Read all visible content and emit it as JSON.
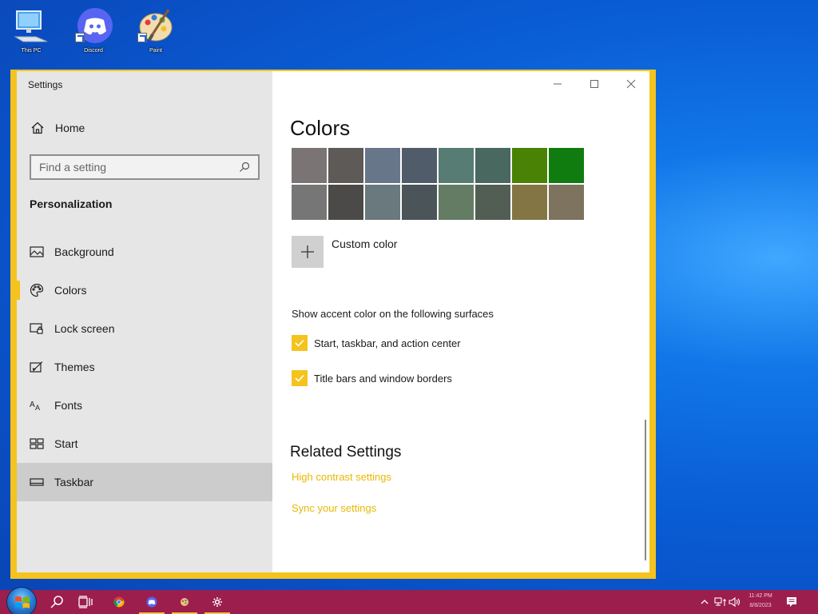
{
  "desktop": {
    "icons": [
      {
        "label": "This PC"
      },
      {
        "label": "Discord"
      },
      {
        "label": "Paint"
      }
    ]
  },
  "window": {
    "title": "Settings",
    "accent_color": "#f5c31d",
    "controls": {
      "minimize": "minimize",
      "maximize": "maximize",
      "close": "close"
    }
  },
  "sidebar": {
    "home_label": "Home",
    "search_placeholder": "Find a setting",
    "section_label": "Personalization",
    "items": [
      {
        "label": "Background",
        "icon": "picture-icon"
      },
      {
        "label": "Colors",
        "icon": "palette-icon"
      },
      {
        "label": "Lock screen",
        "icon": "lock-screen-icon"
      },
      {
        "label": "Themes",
        "icon": "themes-icon"
      },
      {
        "label": "Fonts",
        "icon": "fonts-icon"
      },
      {
        "label": "Start",
        "icon": "start-icon"
      },
      {
        "label": "Taskbar",
        "icon": "taskbar-icon"
      }
    ],
    "selected_item": "Colors",
    "hovered_item": "Taskbar"
  },
  "main": {
    "title": "Colors",
    "swatches": [
      "#7a7574",
      "#5d5a58",
      "#68768a",
      "#515c6b",
      "#567c73",
      "#486860",
      "#498205",
      "#107c10",
      "#767676",
      "#4c4a48",
      "#69797e",
      "#4a5459",
      "#647c64",
      "#525e54",
      "#847545",
      "#7e735f"
    ],
    "custom_color_label": "Custom color",
    "surfaces_heading": "Show accent color on the following surfaces",
    "checkboxes": [
      {
        "label": "Start, taskbar, and action center",
        "checked": true
      },
      {
        "label": "Title bars and window borders",
        "checked": true
      }
    ],
    "related_heading": "Related Settings",
    "links": [
      {
        "label": "High contrast settings"
      },
      {
        "label": "Sync your settings"
      }
    ],
    "link_color": "#e8b800"
  },
  "taskbar": {
    "background": "#9c1e4c",
    "clock_time": "11:42 PM",
    "clock_date": "8/8/2023"
  }
}
